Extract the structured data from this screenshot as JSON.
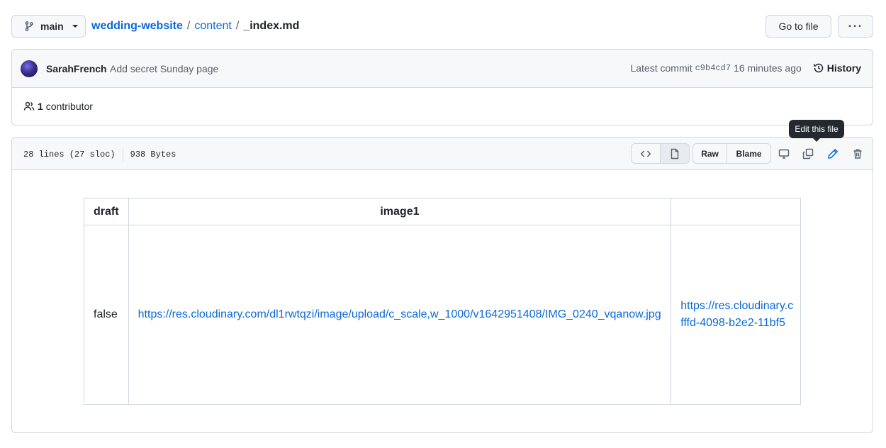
{
  "branch": {
    "name": "main"
  },
  "breadcrumb": {
    "repo": "wedding-website",
    "folder": "content",
    "sep": "/",
    "file": "_index.md"
  },
  "actions": {
    "goto_file": "Go to file",
    "more": "···"
  },
  "commit": {
    "author": "SarahFrench",
    "message": "Add secret Sunday page",
    "latest_label": "Latest commit",
    "sha": "c9b4cd7",
    "time": "16 minutes ago",
    "history": "History"
  },
  "contributors": {
    "count": "1",
    "label": "contributor"
  },
  "file": {
    "lines": "28 lines (27 sloc)",
    "size": "938 Bytes",
    "raw": "Raw",
    "blame": "Blame",
    "tooltip": "Edit this file"
  },
  "table": {
    "headers": [
      "draft",
      "image1",
      ""
    ],
    "row": {
      "draft": "false",
      "image1": "https://res.cloudinary.com/dl1rwtqzi/image/upload/c_scale,w_1000/v1642951408/IMG_0240_vqanow.jpg",
      "image2": "https://res.cloudinary.c\nfffd-4098-b2e2-11bf5"
    }
  },
  "colors": {
    "link": "#0969da",
    "border": "#d0d7de",
    "header_bg": "#f6f8fa",
    "tooltip_bg": "#24292f"
  }
}
